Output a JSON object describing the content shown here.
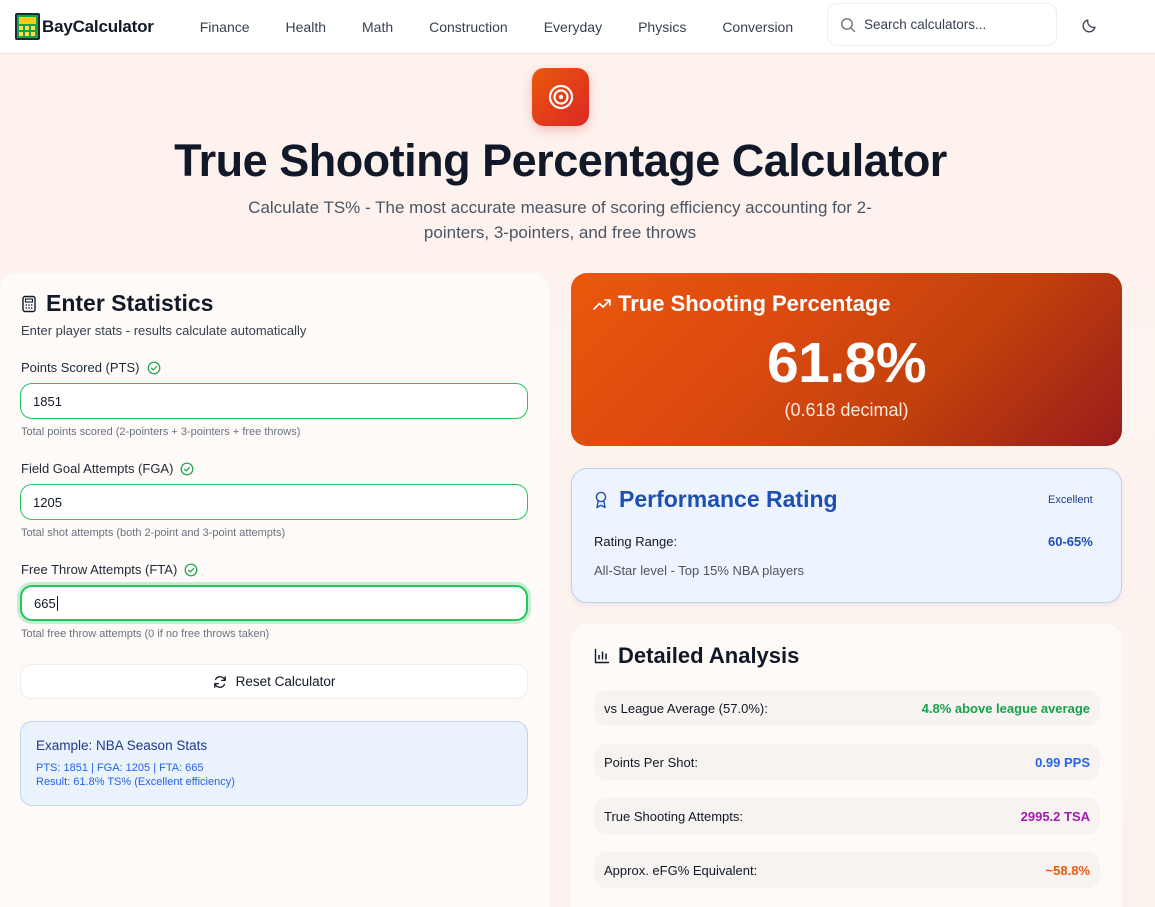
{
  "brand": {
    "name": "BayCalculator"
  },
  "nav": {
    "items": [
      "Finance",
      "Health",
      "Math",
      "Construction",
      "Everyday",
      "Physics",
      "Conversion"
    ]
  },
  "search": {
    "placeholder": "Search calculators..."
  },
  "hero": {
    "title": "True Shooting Percentage Calculator",
    "subtitle": "Calculate TS% - The most accurate measure of scoring efficiency accounting for 2-pointers, 3-pointers, and free throws"
  },
  "form": {
    "title": "Enter Statistics",
    "description": "Enter player stats - results calculate automatically",
    "fields": [
      {
        "label": "Points Scored (PTS)",
        "value": "1851",
        "hint": "Total points scored (2-pointers + 3-pointers + free throws)"
      },
      {
        "label": "Field Goal Attempts (FGA)",
        "value": "1205",
        "hint": "Total shot attempts (both 2-point and 3-point attempts)"
      },
      {
        "label": "Free Throw Attempts (FTA)",
        "value": "665",
        "hint": "Total free throw attempts (0 if no free throws taken)"
      }
    ],
    "reset_label": "Reset Calculator",
    "example": {
      "title": "Example: NBA Season Stats",
      "line1": "PTS: 1851 | FGA: 1205 | FTA: 665",
      "line2": "Result: 61.8% TS% (Excellent efficiency)"
    }
  },
  "result": {
    "title": "True Shooting Percentage",
    "value": "61.8%",
    "decimal": "(0.618 decimal)"
  },
  "rating": {
    "title": "Performance Rating",
    "badge": "Excellent",
    "range_label": "Rating Range:",
    "range_value": "60-65%",
    "description": "All-Star level - Top 15% NBA players"
  },
  "analysis": {
    "title": "Detailed Analysis",
    "rows": [
      {
        "label": "vs League Average (57.0%):",
        "value": "4.8% above league average",
        "color": "#16a34a"
      },
      {
        "label": "Points Per Shot:",
        "value": "0.99 PPS",
        "color": "#2563eb"
      },
      {
        "label": "True Shooting Attempts:",
        "value": "2995.2 TSA",
        "color": "#a21caf"
      },
      {
        "label": "Approx. eFG% Equivalent:",
        "value": "~58.8%",
        "color": "#ea580c"
      }
    ]
  }
}
